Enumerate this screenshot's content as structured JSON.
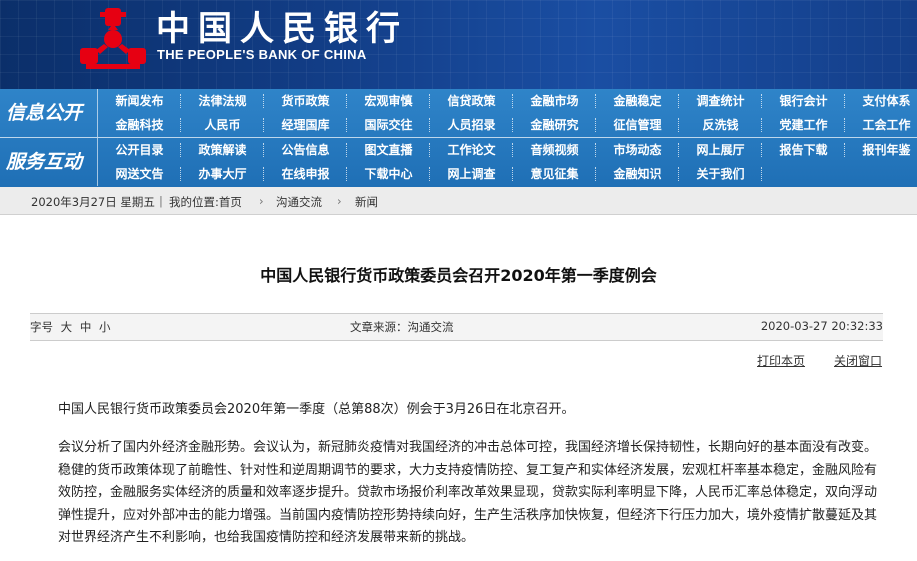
{
  "header": {
    "bank_name_cn": "中国人民银行",
    "bank_name_en": "THE PEOPLE'S BANK OF CHINA",
    "logo_color": "#e60012",
    "banner_color": "#123d86"
  },
  "nav": {
    "section_public": "信息公开",
    "section_interaction": "服务互动",
    "row1": [
      "新闻发布",
      "法律法规",
      "货币政策",
      "宏观审慎",
      "信贷政策",
      "金融市场",
      "金融稳定",
      "调查统计",
      "银行会计",
      "支付体系"
    ],
    "row2": [
      "金融科技",
      "人民币",
      "经理国库",
      "国际交往",
      "人员招录",
      "金融研究",
      "征信管理",
      "反洗钱",
      "党建工作",
      "工会工作"
    ],
    "row3": [
      "公开目录",
      "政策解读",
      "公告信息",
      "图文直播",
      "工作论文",
      "音频视频",
      "市场动态",
      "网上展厅",
      "报告下载",
      "报刊年鉴"
    ],
    "row4": [
      "网送文告",
      "办事大厅",
      "在线申报",
      "下载中心",
      "网上调查",
      "意见征集",
      "金融知识",
      "关于我们"
    ]
  },
  "breadcrumb": {
    "date": "2020年3月27日 星期五",
    "location_label": "我的位置:首页",
    "level1": "沟通交流",
    "level2": "新闻"
  },
  "article": {
    "title": "中国人民银行货币政策委员会召开2020年第一季度例会",
    "font_label": "字号",
    "font_large": "大",
    "font_medium": "中",
    "font_small": "小",
    "source": "文章来源：沟通交流",
    "datetime": "2020-03-27 20:32:33",
    "print_label": "打印本页",
    "close_label": "关闭窗口",
    "paragraph1": "中国人民银行货币政策委员会2020年第一季度（总第88次）例会于3月26日在北京召开。",
    "paragraph2": "会议分析了国内外经济金融形势。会议认为，新冠肺炎疫情对我国经济的冲击总体可控，我国经济增长保持韧性，长期向好的基本面没有改变。稳健的货币政策体现了前瞻性、针对性和逆周期调节的要求，大力支持疫情防控、复工复产和实体经济发展，宏观杠杆率基本稳定，金融风险有效防控，金融服务实体经济的质量和效率逐步提升。贷款市场报价利率改革效果显现，贷款实际利率明显下降，人民币汇率总体稳定，双向浮动弹性提升，应对外部冲击的能力增强。当前国内疫情防控形势持续向好，生产生活秩序加快恢复，但经济下行压力加大，境外疫情扩散蔓延及其对世界经济产生不利影响，也给我国疫情防控和经济发展带来新的挑战。"
  }
}
